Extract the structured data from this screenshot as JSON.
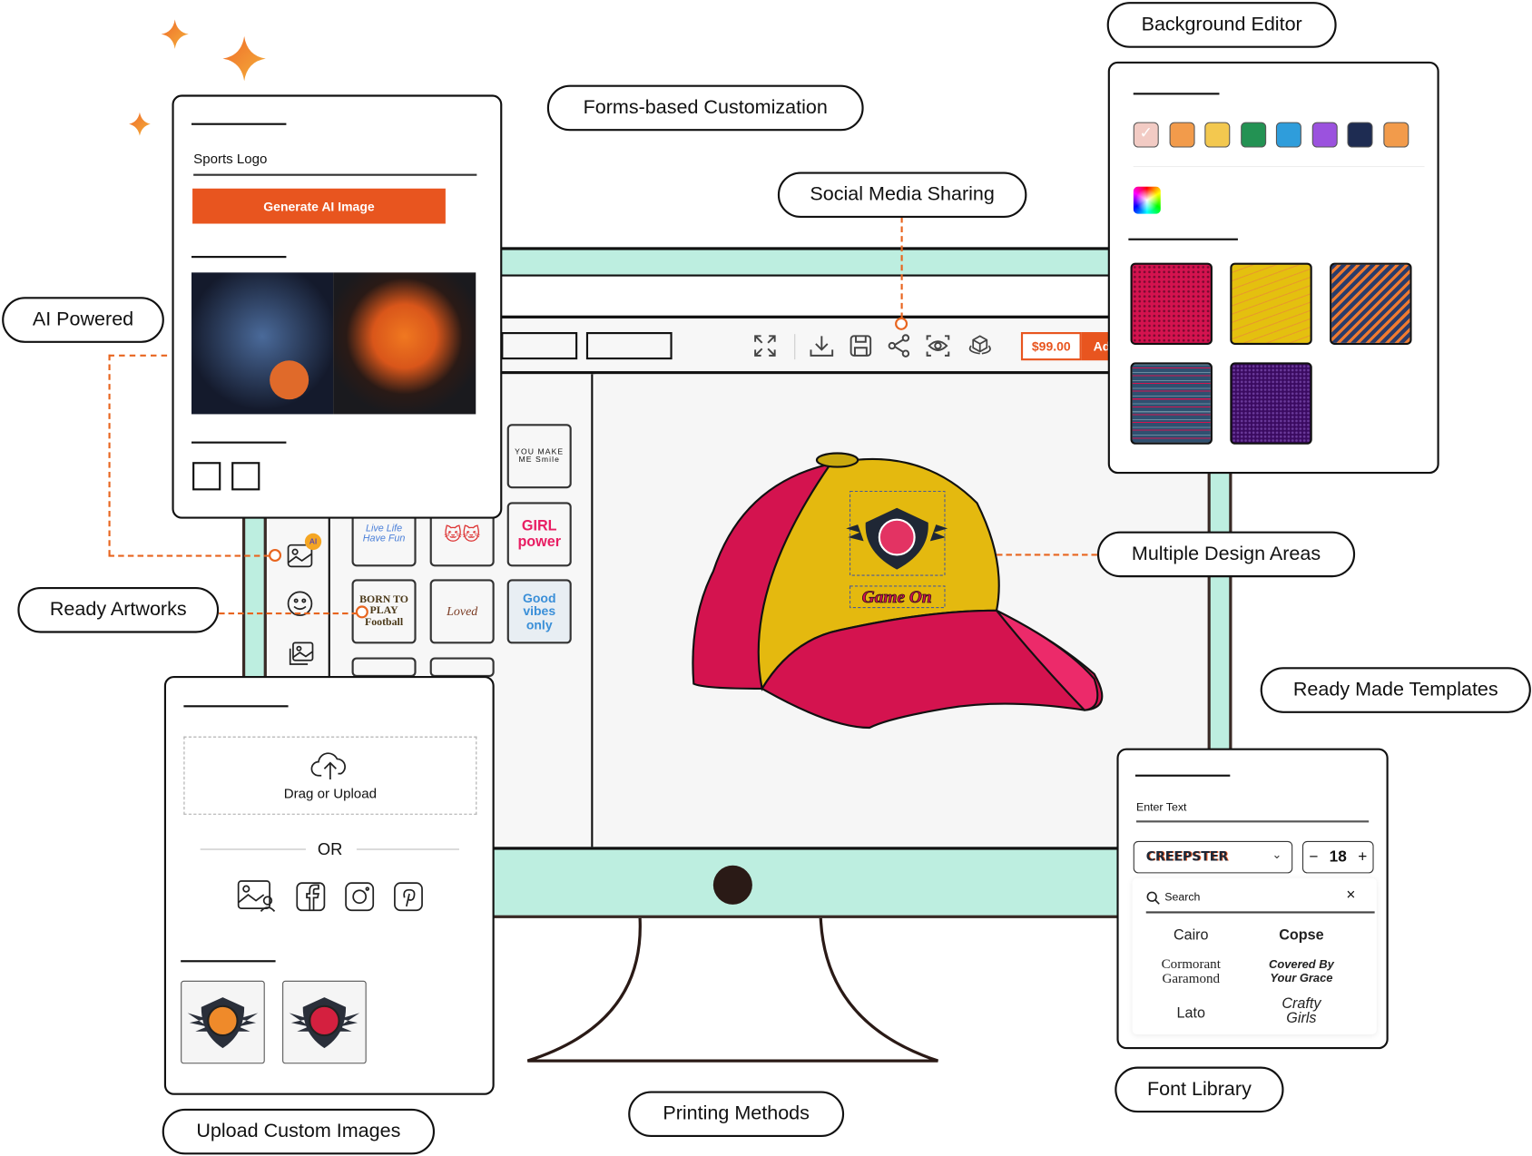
{
  "labels": {
    "background_editor": "Background Editor",
    "forms_customization": "Forms-based Customization",
    "social_sharing": "Social Media Sharing",
    "ai_powered": "AI Powered",
    "multiple_design_areas": "Multiple Design Areas",
    "ready_artworks": "Ready Artworks",
    "ready_made_templates": "Ready Made Templates",
    "upload_custom_images": "Upload Custom Images",
    "printing_methods": "Printing Methods",
    "font_library": "Font Library"
  },
  "ai_panel": {
    "prompt_value": "Sports Logo",
    "generate_button": "Generate AI Image"
  },
  "toolbar": {
    "icons": [
      "fullscreen-icon",
      "download-icon",
      "save-icon",
      "share-icon",
      "preview-icon",
      "3d-view-icon"
    ],
    "price": "$99.00",
    "add_button": "Add"
  },
  "sidebar": {
    "ai_badge": "AI",
    "icons": [
      "ai-image-icon",
      "emoji-icon",
      "gallery-icon"
    ]
  },
  "artworks": [
    {
      "text": "YOU MAKE ME Smile"
    },
    {
      "text": "Live Life Have Fun"
    },
    {
      "text": "cats"
    },
    {
      "text": "GIRL power"
    },
    {
      "text": "BORN TO PLAY Football"
    },
    {
      "text": "Loved"
    },
    {
      "text": "Good vibes only"
    }
  ],
  "design": {
    "text": "Game On"
  },
  "upload_panel": {
    "drop_label": "Drag or Upload",
    "or_label": "OR",
    "sources": [
      "image-icon",
      "facebook-icon",
      "instagram-icon",
      "pinterest-icon"
    ]
  },
  "background_panel": {
    "colors": [
      "#f2cbc4",
      "#f29b4b",
      "#f3c84f",
      "#239253",
      "#2f9ddb",
      "#9b52de",
      "#1e2c52",
      "#f29b4b"
    ],
    "selected_color": "#f2cbc4",
    "patterns": [
      "crimson-dots",
      "yellow-waves",
      "orange-navy-stripes",
      "navy-pink-lines",
      "purple-chevrons"
    ]
  },
  "font_panel": {
    "enter_text_label": "Enter Text",
    "selected_font": "CREEPSTER",
    "size": "18",
    "search_placeholder": "Search",
    "fonts": [
      "Cairo",
      "Copse",
      "Cormorant Garamond",
      "Covered By Your Grace",
      "Lato",
      "Crafty Girls"
    ]
  },
  "colors": {
    "accent": "#e8551f",
    "mint": "#bdeee0",
    "hat_yellow": "#e4b90f",
    "hat_pink": "#d4134f"
  }
}
